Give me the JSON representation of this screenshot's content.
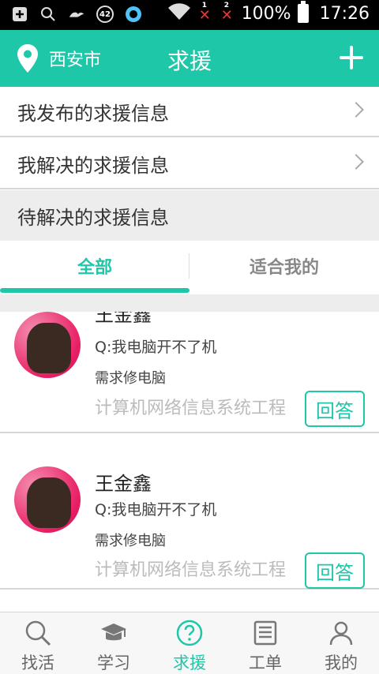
{
  "status_bar": {
    "badge_number": "42",
    "sim1": "1",
    "sim2": "2",
    "battery": "100%",
    "time": "17:26",
    "icons": [
      "add-box-icon",
      "search-icon",
      "weather-icon",
      "notification-42-icon",
      "app-q-icon",
      "wifi-icon",
      "no-signal-sim1-icon",
      "no-signal-sim2-icon",
      "battery-icon"
    ]
  },
  "header": {
    "location": "西安市",
    "title": "求援",
    "add_icon": "plus-icon",
    "accent": "#1fc7a9"
  },
  "menu": {
    "published": "我发布的求援信息",
    "solved": "我解决的求援信息",
    "pending_section": "待解决的求援信息"
  },
  "tabs": [
    {
      "label": "全部",
      "active": true
    },
    {
      "label": "适合我的",
      "active": false
    }
  ],
  "requests": [
    {
      "name": "王金鑫",
      "question": "Q:我电脑开不了机",
      "need": "需求修电脑",
      "category": "计算机网络信息系统工程",
      "answer": "回答"
    },
    {
      "name": "王金鑫",
      "question": "Q:我电脑开不了机",
      "need": "需求修电脑",
      "category": "计算机网络信息系统工程",
      "answer": "回答"
    }
  ],
  "bottom_nav": [
    {
      "label": "找活",
      "icon": "search-icon",
      "active": false
    },
    {
      "label": "学习",
      "icon": "graduation-cap-icon",
      "active": false
    },
    {
      "label": "求援",
      "icon": "help-circle-icon",
      "active": true
    },
    {
      "label": "工单",
      "icon": "list-document-icon",
      "active": false
    },
    {
      "label": "我的",
      "icon": "person-icon",
      "active": false
    }
  ]
}
